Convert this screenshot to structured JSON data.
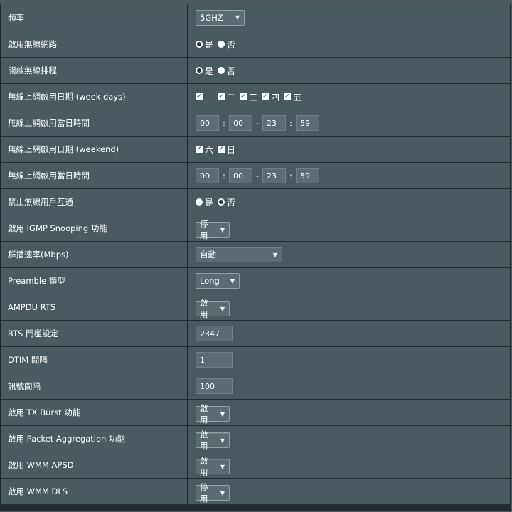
{
  "rows": {
    "frequency": {
      "label": "頻率",
      "value": "5GHZ"
    },
    "enable_wireless": {
      "label": "啟用無線網路",
      "options": [
        "是",
        "否"
      ],
      "selected": "是"
    },
    "enable_schedule": {
      "label": "開啟無線排程",
      "options": [
        "是",
        "否"
      ],
      "selected": "是"
    },
    "weekday_days": {
      "label": "無線上網啟用日期 (week days)",
      "days": [
        "一",
        "二",
        "三",
        "四",
        "五"
      ],
      "checked": [
        true,
        true,
        true,
        true,
        true
      ]
    },
    "weekday_time": {
      "label": "無線上網啟用當日時間",
      "start_h": "00",
      "start_m": "00",
      "end_h": "23",
      "end_m": "59"
    },
    "weekend_days": {
      "label": "無線上網啟用日期 (weekend)",
      "days": [
        "六",
        "日"
      ],
      "checked": [
        true,
        true
      ]
    },
    "weekend_time": {
      "label": "無線上網啟用當日時間",
      "start_h": "00",
      "start_m": "00",
      "end_h": "23",
      "end_m": "59"
    },
    "ap_isolation": {
      "label": "禁止無線用戶互通",
      "options": [
        "是",
        "否"
      ],
      "selected": "否"
    },
    "igmp_snooping": {
      "label": "啟用 IGMP Snooping 功能",
      "value": "停用"
    },
    "multicast_rate": {
      "label": "群播速率(Mbps)",
      "value": "自動"
    },
    "preamble": {
      "label": "Preamble 類型",
      "value": "Long"
    },
    "ampdu_rts": {
      "label": "AMPDU RTS",
      "value": "啟用"
    },
    "rts_threshold": {
      "label": "RTS 門檻設定",
      "value": "2347"
    },
    "dtim": {
      "label": "DTIM 間隔",
      "value": "1"
    },
    "beacon": {
      "label": "訊號間隔",
      "value": "100"
    },
    "tx_burst": {
      "label": "啟用 TX Burst 功能",
      "value": "啟用"
    },
    "packet_aggregation": {
      "label": "啟用 Packet Aggregation 功能",
      "value": "啟用"
    },
    "wmm_apsd": {
      "label": "啟用 WMM APSD",
      "value": "啟用"
    },
    "wmm_dls": {
      "label": "啟用 WMM DLS",
      "value": "停用"
    }
  },
  "symbols": {
    "dropdown_arrow": "▼",
    "checkmark": "✓",
    "time_colon": ":",
    "time_dash": "-"
  },
  "colors": {
    "label_bg": "#4b5a60",
    "control_bg": "#475a5f",
    "border": "#222b2f",
    "page_bg": "#4d595d"
  }
}
